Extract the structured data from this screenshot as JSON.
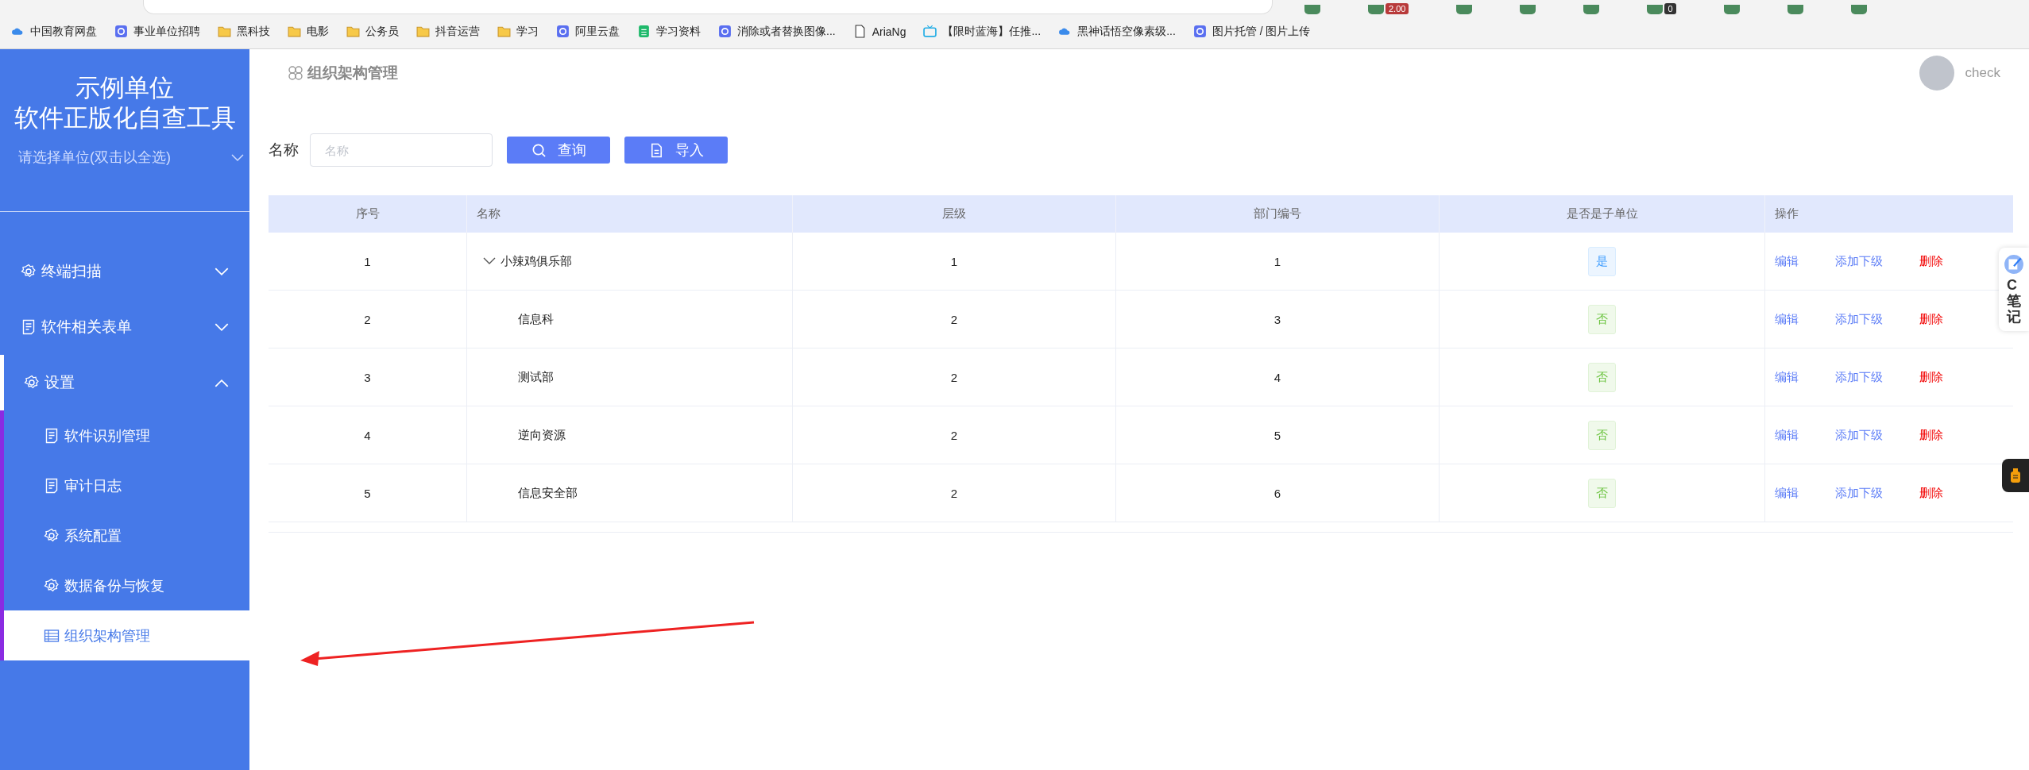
{
  "browser": {
    "extension_badges": [
      "2.00",
      "0"
    ],
    "bookmarks": [
      {
        "label": "中国教育网盘",
        "kind": "cloud"
      },
      {
        "label": "事业单位招聘",
        "kind": "site"
      },
      {
        "label": "黑科技",
        "kind": "folder"
      },
      {
        "label": "电影",
        "kind": "folder"
      },
      {
        "label": "公务员",
        "kind": "folder"
      },
      {
        "label": "抖音运营",
        "kind": "folder"
      },
      {
        "label": "学习",
        "kind": "folder"
      },
      {
        "label": "阿里云盘",
        "kind": "site"
      },
      {
        "label": "学习资料",
        "kind": "sheet"
      },
      {
        "label": "消除或者替换图像...",
        "kind": "site"
      },
      {
        "label": "AriaNg",
        "kind": "page"
      },
      {
        "label": "【限时蓝海】任推...",
        "kind": "tv"
      },
      {
        "label": "黑神话悟空像素级...",
        "kind": "cloud"
      },
      {
        "label": "图片托管 / 图片上传",
        "kind": "site"
      }
    ]
  },
  "sidebar": {
    "org": "示例单位",
    "app_title": "软件正版化自查工具",
    "unit_select": {
      "placeholder": "请选择单位(双击以全选)"
    },
    "menu": [
      {
        "label": "终端扫描",
        "kind": "gear",
        "expanded": false
      },
      {
        "label": "软件相关表单",
        "kind": "doc",
        "expanded": false
      },
      {
        "label": "设置",
        "kind": "gear",
        "expanded": true,
        "children": [
          {
            "label": "软件识别管理",
            "kind": "doc",
            "selected": false
          },
          {
            "label": "审计日志",
            "kind": "doc",
            "selected": false
          },
          {
            "label": "系统配置",
            "kind": "gear",
            "selected": false
          },
          {
            "label": "数据备份与恢复",
            "kind": "gear",
            "selected": false
          },
          {
            "label": "组织架构管理",
            "kind": "grid",
            "selected": true
          }
        ]
      }
    ]
  },
  "header": {
    "breadcrumb": "组织架构管理",
    "user": "check"
  },
  "search": {
    "label": "名称",
    "placeholder": "名称",
    "buttons": [
      {
        "label": "查询",
        "kind": "search"
      },
      {
        "label": "导入",
        "kind": "import"
      }
    ]
  },
  "table": {
    "columns": [
      "序号",
      "名称",
      "层级",
      "部门编号",
      "是否是子单位",
      "操作"
    ],
    "rows": [
      {
        "index": "1",
        "name": "小辣鸡俱乐部",
        "level": "1",
        "code": "1",
        "sub_unit": "是",
        "is_sub_unit": true,
        "expanded": true,
        "actions": [
          "编辑",
          "添加下级",
          "删除"
        ],
        "children": [
          {
            "index": "2",
            "name": "信息科",
            "level": "2",
            "code": "3",
            "sub_unit": "否",
            "is_sub_unit": false,
            "actions": [
              "编辑",
              "添加下级",
              "删除"
            ]
          },
          {
            "index": "3",
            "name": "测试部",
            "level": "2",
            "code": "4",
            "sub_unit": "否",
            "is_sub_unit": false,
            "actions": [
              "编辑",
              "添加下级",
              "删除"
            ]
          },
          {
            "index": "4",
            "name": "逆向资源",
            "level": "2",
            "code": "5",
            "sub_unit": "否",
            "is_sub_unit": false,
            "actions": [
              "编辑",
              "添加下级",
              "删除"
            ]
          },
          {
            "index": "5",
            "name": "信息安全部",
            "level": "2",
            "code": "6",
            "sub_unit": "否",
            "is_sub_unit": false,
            "actions": [
              "编辑",
              "添加下级",
              "删除"
            ]
          }
        ]
      }
    ]
  },
  "side_widget": {
    "label": "C笔记"
  }
}
